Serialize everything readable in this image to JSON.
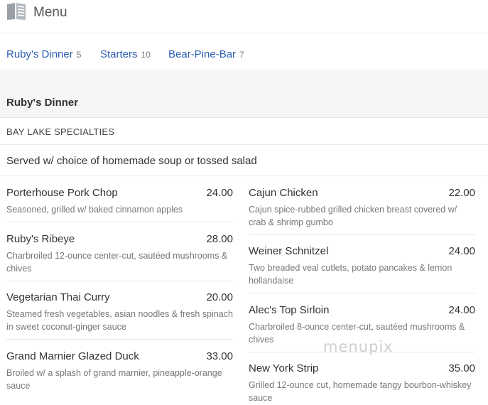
{
  "header": {
    "title": "Menu",
    "icon": "menu-book-icon"
  },
  "tabs": [
    {
      "label": "Ruby's Dinner",
      "count": "5"
    },
    {
      "label": "Starters",
      "count": "10"
    },
    {
      "label": "Bear-Pine-Bar",
      "count": "7"
    }
  ],
  "section": {
    "title": "Ruby's Dinner",
    "subheading": "BAY LAKE SPECIALTIES",
    "description": "Served w/ choice of homemade soup or tossed salad"
  },
  "items_left": [
    {
      "name": "Porterhouse Pork Chop",
      "price": "24.00",
      "desc": "Seasoned, grilled w/ baked cinnamon apples"
    },
    {
      "name": "Ruby's Ribeye",
      "price": "28.00",
      "desc": "Charbroiled 12-ounce center-cut, sautéed mushrooms & chives"
    },
    {
      "name": "Vegetarian Thai Curry",
      "price": "20.00",
      "desc": "Steamed fresh vegetables, asian noodles & fresh spinach in sweet coconut-ginger sauce"
    },
    {
      "name": "Grand Marnier Glazed Duck",
      "price": "33.00",
      "desc": "Broiled w/ a splash of grand marnier, pineapple-orange sauce"
    }
  ],
  "items_right": [
    {
      "name": "Cajun Chicken",
      "price": "22.00",
      "desc": "Cajun spice-rubbed grilled chicken breast covered w/ crab & shrimp gumbo"
    },
    {
      "name": "Weiner Schnitzel",
      "price": "24.00",
      "desc": "Two breaded veal cutlets, potato pancakes & lemon hollandaise"
    },
    {
      "name": "Alec's Top Sirloin",
      "price": "24.00",
      "desc": "Charbroiled 8-ounce center-cut, sautéed mushrooms & chives"
    },
    {
      "name": "New York Strip",
      "price": "35.00",
      "desc": "Grilled 12-ounce cut, homemade tangy bourbon-whiskey sauce"
    }
  ],
  "watermark": "menupix"
}
